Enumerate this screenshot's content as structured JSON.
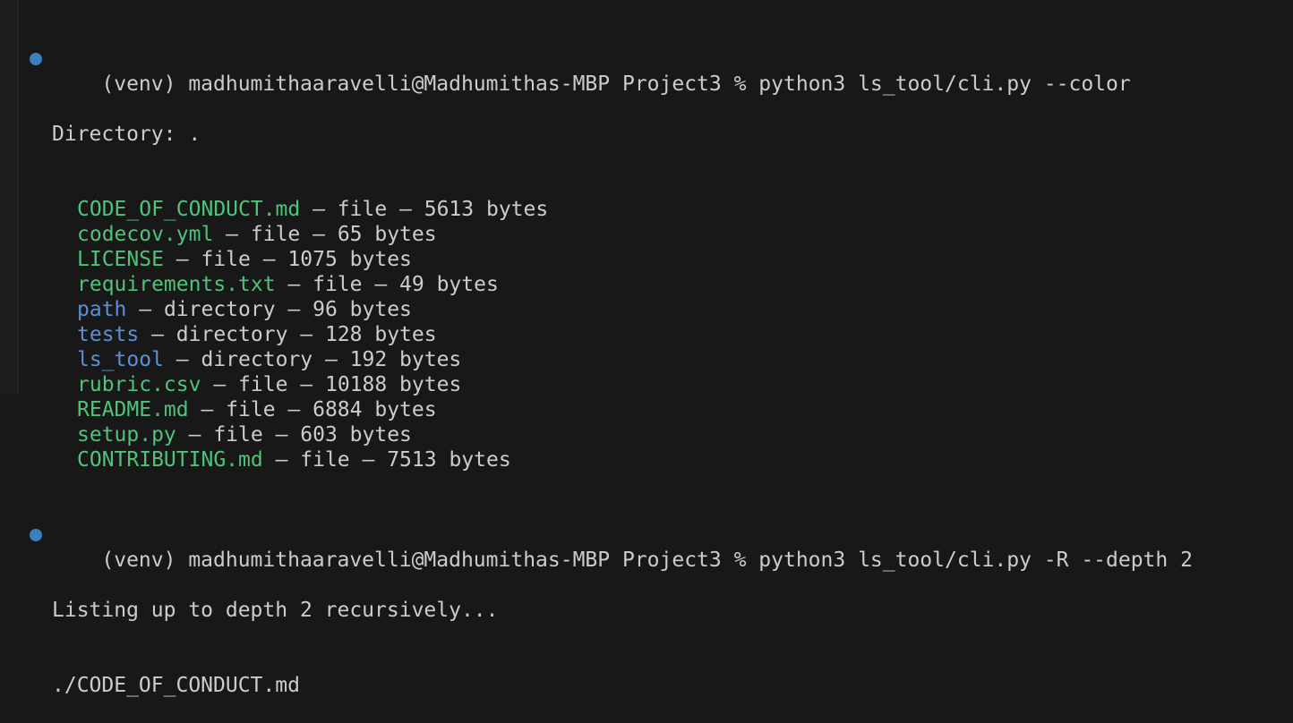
{
  "colors": {
    "background": "#181818",
    "text": "#cccccc",
    "file": "#4ec37a",
    "directory": "#5b8fd6",
    "prompt_dot": "#3b7fbf"
  },
  "commands": [
    {
      "prompt": "(venv) madhumithaaravelli@Madhumithas-MBP Project3 % python3 ls_tool/cli.py --color"
    },
    {
      "prompt": "(venv) madhumithaaravelli@Madhumithas-MBP Project3 % python3 ls_tool/cli.py -R --depth 2"
    }
  ],
  "output1": {
    "header": "Directory: .",
    "separator": " – ",
    "entries": [
      {
        "name": "CODE_OF_CONDUCT.md",
        "kind": "file",
        "size": "5613 bytes"
      },
      {
        "name": "codecov.yml",
        "kind": "file",
        "size": "65 bytes"
      },
      {
        "name": "LICENSE",
        "kind": "file",
        "size": "1075 bytes"
      },
      {
        "name": "requirements.txt",
        "kind": "file",
        "size": "49 bytes"
      },
      {
        "name": "path",
        "kind": "directory",
        "size": "96 bytes"
      },
      {
        "name": "tests",
        "kind": "directory",
        "size": "128 bytes"
      },
      {
        "name": "ls_tool",
        "kind": "directory",
        "size": "192 bytes"
      },
      {
        "name": "rubric.csv",
        "kind": "file",
        "size": "10188 bytes"
      },
      {
        "name": "README.md",
        "kind": "file",
        "size": "6884 bytes"
      },
      {
        "name": "setup.py",
        "kind": "file",
        "size": "603 bytes"
      },
      {
        "name": "CONTRIBUTING.md",
        "kind": "file",
        "size": "7513 bytes"
      }
    ]
  },
  "output2": {
    "lines": [
      "Listing up to depth 2 recursively...",
      "./CODE_OF_CONDUCT.md"
    ]
  }
}
